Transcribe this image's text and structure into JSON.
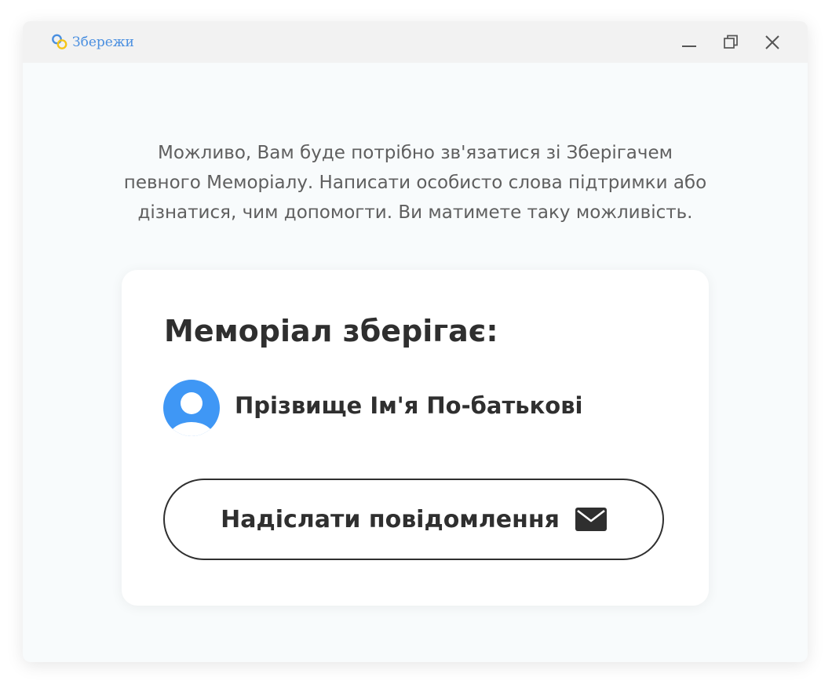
{
  "app": {
    "logo_text": "Збережи",
    "brand_colors": {
      "blue": "#4a8fe0",
      "yellow": "#f5c518"
    }
  },
  "window_controls": {
    "minimize_icon": "minimize-icon",
    "restore_icon": "restore-icon",
    "close_icon": "close-icon"
  },
  "main": {
    "intro_text": "Можливо, Вам буде потрібно зв'язатися зі Зберігачем певного Меморіалу. Написати особисто слова підтримки або дізнатися, чим допомогти. Ви матимете таку можливість."
  },
  "card": {
    "title": "Меморіал зберігає:",
    "person_name": "Прізвище Ім'я По-батькові",
    "avatar_icon": "user-avatar-icon",
    "avatar_color": "#3f97f5",
    "send_button_label": "Надіслати повідомлення",
    "send_button_icon": "envelope-icon"
  }
}
